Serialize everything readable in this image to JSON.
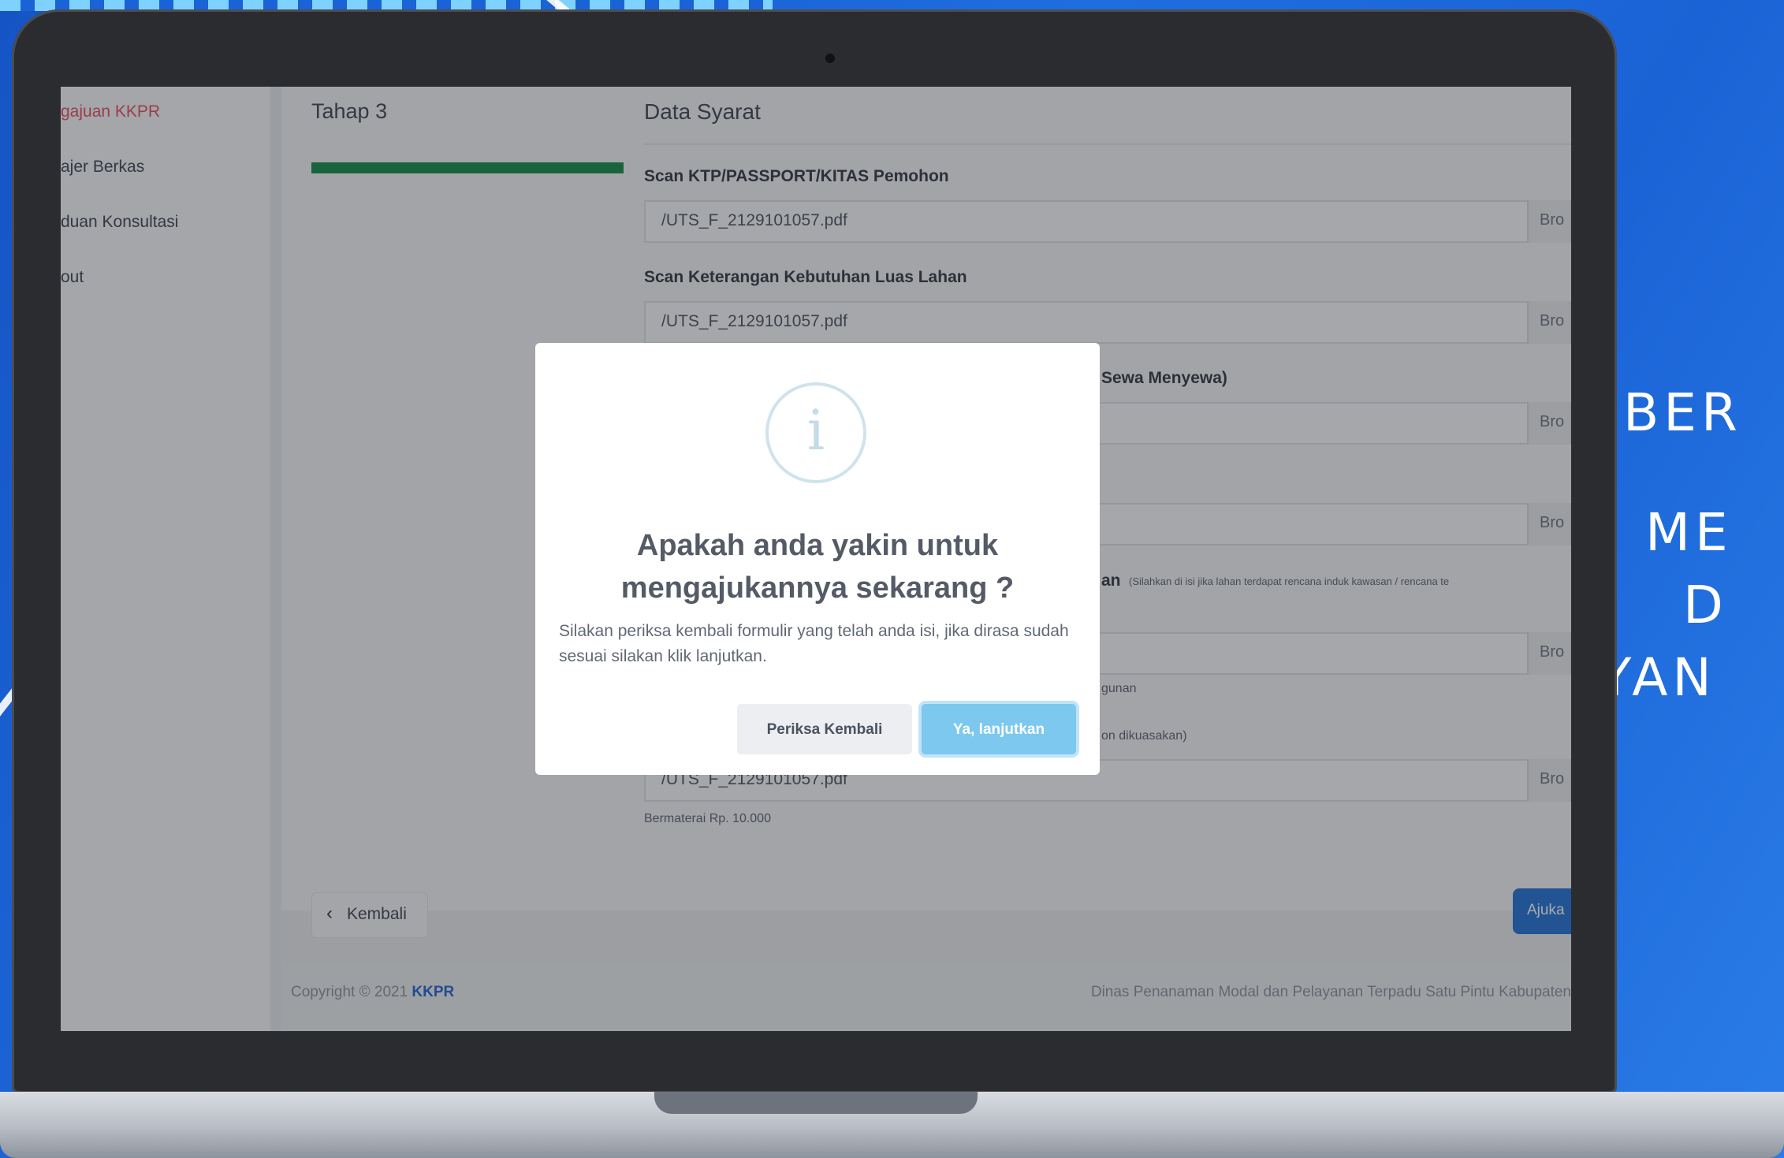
{
  "side_text": {
    "line1": "BER",
    "line2": "ME",
    "line3": "D",
    "line4": "YAN"
  },
  "sidebar": {
    "items": [
      {
        "label": "gajuan KKPR",
        "active": true
      },
      {
        "label": "ajer Berkas"
      },
      {
        "label": "duan Konsultasi"
      },
      {
        "label": "out"
      }
    ]
  },
  "main": {
    "stage": "Tahap 3",
    "section_title": "Data Syarat",
    "browse_label": "Bro",
    "fields": [
      {
        "label": "Scan KTP/PASSPORT/KITAS Pemohon",
        "value": "/UTS_F_2129101057.pdf"
      },
      {
        "label": "Scan Keterangan Kebutuhan Luas Lahan",
        "value": "/UTS_F_2129101057.pdf"
      },
      {
        "label": "Sewa Menyewa)",
        "value": ""
      },
      {
        "label": "",
        "value": ""
      },
      {
        "label": "an",
        "hint": "(Silahkan di isi jika lahan terdapat rencana induk kawasan / rencana te",
        "value": ""
      },
      {
        "label": "",
        "value": ""
      },
      {
        "label": "",
        "value": "/UTS_F_2129101057.pdf"
      }
    ],
    "hint_gunan": "gunan",
    "hint_dikuasakan": "on dikuasakan)",
    "hint_materai": "Bermaterai Rp. 10.000",
    "back_label": "Kembali",
    "submit_label": "Ajuka"
  },
  "footer": {
    "copyright": "Copyright © 2021 ",
    "brand": "KKPR",
    "agency": "Dinas Penanaman Modal dan Pelayanan Terpadu Satu Pintu Kabupaten"
  },
  "modal": {
    "icon": "i",
    "title_line1": "Apakah anda yakin untuk",
    "title_line2": "mengajukannya sekarang ?",
    "text": "Silakan periksa kembali formulir yang telah anda isi, jika dirasa sudah sesuai silakan klik lanjutkan.",
    "check_label": "Periksa Kembali",
    "confirm_label": "Ya, lanjutkan"
  },
  "colors": {
    "accent": "#1f6fd6",
    "progress": "#0f8a45",
    "active_nav": "#e84a5f",
    "confirm": "#7cc8ee"
  }
}
